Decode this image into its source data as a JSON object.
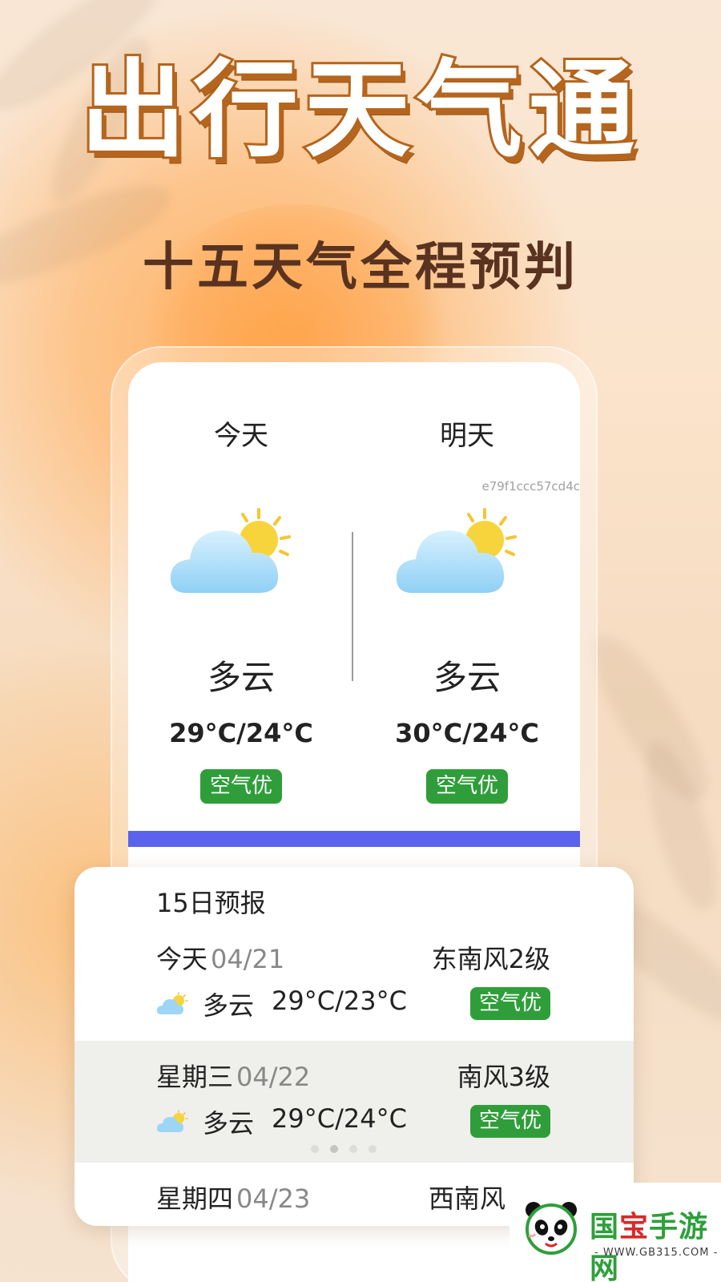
{
  "hero": {
    "title": "出行天气通",
    "subtitle": "十五天气全程预判"
  },
  "overview": {
    "hash_text": "e79f1ccc57cd4c",
    "days": [
      {
        "label": "今天",
        "condition": "多云",
        "temp": "29°C/24°C",
        "air_quality": "空气优",
        "icon": "partly-cloudy-icon"
      },
      {
        "label": "明天",
        "condition": "多云",
        "temp": "30°C/24°C",
        "air_quality": "空气优",
        "icon": "partly-cloudy-icon"
      }
    ],
    "accent_bar_color": "#5b62ee"
  },
  "forecast": {
    "title": "15日预报",
    "rows": [
      {
        "day": "今天",
        "date": "04/21",
        "wind": "东南风2级",
        "condition": "多云",
        "temp": "29°C/23°C",
        "air_quality": "空气优",
        "icon": "partly-cloudy-icon"
      },
      {
        "day": "星期三",
        "date": "04/22",
        "wind": "南风3级",
        "condition": "多云",
        "temp": "29°C/24°C",
        "air_quality": "空气优",
        "icon": "partly-cloudy-icon"
      },
      {
        "day": "星期四",
        "date": "04/23",
        "wind": "西南风",
        "condition": "",
        "temp": "",
        "air_quality": "",
        "icon": ""
      }
    ],
    "page_indicator": {
      "total": 4,
      "active": 1
    }
  },
  "watermark": {
    "brand_prefix": "国",
    "brand_red": "宝",
    "brand_suffix": "手游网",
    "url": "- WWW.GB315.COM -"
  },
  "colors": {
    "title_stroke": "#b5651d",
    "subtitle": "#5a3320",
    "air_quality_badge": "#2f9e3a",
    "accent_bar": "#5b62ee"
  }
}
